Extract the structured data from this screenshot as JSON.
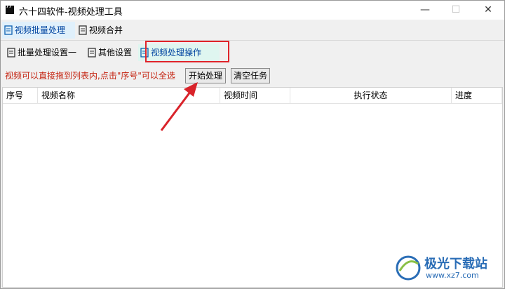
{
  "window": {
    "title": "六十四软件-视频处理工具",
    "controls": {
      "minimize": "—",
      "maximize": "☐",
      "close": "✕"
    }
  },
  "main_tabs": [
    {
      "label": "视频批量处理",
      "active": true
    },
    {
      "label": "视频合并",
      "active": false
    }
  ],
  "sub_tabs": [
    {
      "label": "批量处理设置一",
      "active": false
    },
    {
      "label": "其他设置",
      "active": false
    },
    {
      "label": "视频处理操作",
      "active": true
    }
  ],
  "toolbar": {
    "hint": "视频可以直接拖到列表内,点击\"序号\"可以全选",
    "start_label": "开始处理",
    "clear_label": "清空任务"
  },
  "table": {
    "columns": [
      "序号",
      "视频名称",
      "视频时间",
      "执行状态",
      "进度"
    ],
    "rows": []
  },
  "colors": {
    "highlight_box": "#e0242a",
    "hint_text": "#c4220f",
    "annotation_arrow": "#d9232a",
    "active_tab_text": "#0044a0"
  },
  "watermark": {
    "brand": "极光下载站",
    "url": "www.xz7.com"
  }
}
